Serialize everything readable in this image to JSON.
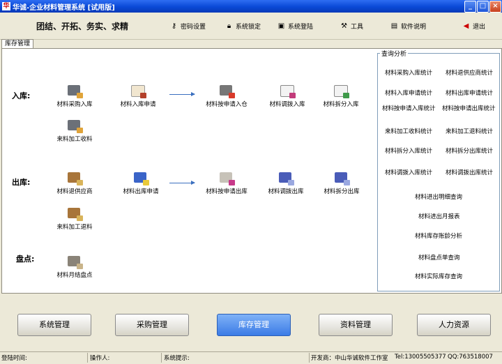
{
  "window": {
    "title": "华诚-企业材料管理系统 [试用版]",
    "app_icon": "华"
  },
  "toolbar": {
    "slogan": "团结、开拓、务实、求精",
    "items": [
      {
        "label": "密码设置",
        "icon": "key-icon"
      },
      {
        "label": "系统锁定",
        "icon": "lock-icon"
      },
      {
        "label": "系统登陆",
        "icon": "login-icon"
      },
      {
        "label": "工具",
        "icon": "hammer-icon"
      },
      {
        "label": "软件说明",
        "icon": "help-book-icon"
      },
      {
        "label": "退出",
        "icon": "exit-arrow-icon"
      }
    ]
  },
  "tab": {
    "label": "库存管理"
  },
  "sections": {
    "inbound": "入库:",
    "outbound": "出库:",
    "stocktake": "盘点:"
  },
  "inbound": {
    "purchase_in": "材料采购入库",
    "in_request": "材料入库申请",
    "in_by_request": "材料按申请入仓",
    "transfer_in": "材料调拨入库",
    "split_in": "材料拆分入库",
    "processing_receive": "来料加工收料"
  },
  "outbound": {
    "return_supplier": "材料退供应商",
    "out_request": "材料出库申请",
    "out_by_request": "材料按申请出库",
    "transfer_out": "材料调拨出库",
    "split_out": "材料拆分出库",
    "processing_return": "来料加工退料"
  },
  "stocktake": {
    "monthly": "材料月结盘点"
  },
  "query": {
    "title": "查询分析",
    "pairs": [
      [
        "材料采购入库统计",
        "材料退供应商统计"
      ],
      [
        "材料入库申请统计",
        "材料出库申请统计"
      ],
      [
        "材料按申请入库统计",
        "材料按申请出库统计"
      ],
      [
        "来料加工收料统计",
        "来料加工退料统计"
      ],
      [
        "材料拆分入库统计",
        "材料拆分出库统计"
      ],
      [
        "材料调拨入库统计",
        "材料调拨出库统计"
      ]
    ],
    "singles": [
      "材料进出明细查询",
      "材料进出月报表",
      "材料库存账龄分析",
      "材料盘点单查询",
      "材料实际库存查询"
    ]
  },
  "modules": [
    "系统管理",
    "采购管理",
    "库存管理",
    "资料管理",
    "人力资源"
  ],
  "active_module": "库存管理",
  "status": {
    "login_time_label": "登陆时间:",
    "operator_label": "操作人:",
    "hint_label": "系统提示:",
    "developer": "开发商：中山华诚软件工作室",
    "tel": "Tel:13005505377",
    "qq": "QQ:763518007"
  },
  "colors": {
    "titlebar": "#0A49D6",
    "arrow": "#3a6fbf",
    "active_module": "#3b7be6"
  }
}
